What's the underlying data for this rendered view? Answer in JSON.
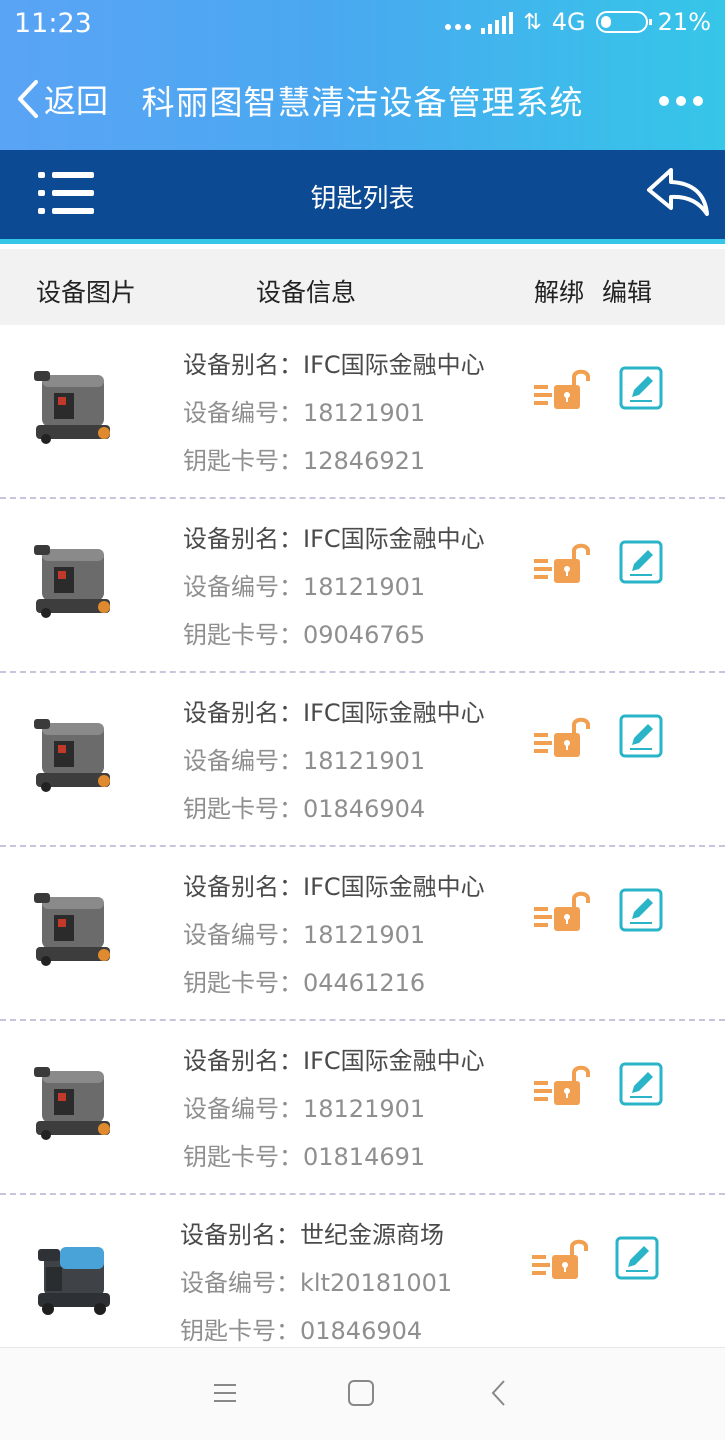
{
  "status_bar": {
    "time": "11:23",
    "network": "4G",
    "battery": "21%"
  },
  "title_bar": {
    "back_label": "返回",
    "title": "科丽图智慧清洁设备管理系统"
  },
  "sub_bar": {
    "title": "钥匙列表"
  },
  "table_header": {
    "col_image": "设备图片",
    "col_info": "设备信息",
    "col_unbind": "解绑",
    "col_edit": "编辑"
  },
  "labels": {
    "alias": "设备别名：",
    "number": "设备编号：",
    "card": "钥匙卡号："
  },
  "items": [
    {
      "alias": "IFC国际金融中心",
      "number": "18121901",
      "card": "12846921",
      "machine": "gray"
    },
    {
      "alias": "IFC国际金融中心",
      "number": "18121901",
      "card": "09046765",
      "machine": "gray"
    },
    {
      "alias": "IFC国际金融中心",
      "number": "18121901",
      "card": "01846904",
      "machine": "gray"
    },
    {
      "alias": "IFC国际金融中心",
      "number": "18121901",
      "card": "04461216",
      "machine": "gray"
    },
    {
      "alias": "IFC国际金融中心",
      "number": "18121901",
      "card": "01814691",
      "machine": "gray"
    },
    {
      "alias": "世纪金源商场",
      "number": "klt20181001",
      "card": "01846904",
      "machine": "blue"
    }
  ],
  "colors": {
    "accent_orange": "#f0a050",
    "accent_teal": "#2ab4c8",
    "dark_bar": "#0c4a93"
  },
  "icons": [
    "menu-icon",
    "reply-icon",
    "unlock-icon",
    "edit-icon",
    "back-chevron-icon",
    "more-icon"
  ]
}
